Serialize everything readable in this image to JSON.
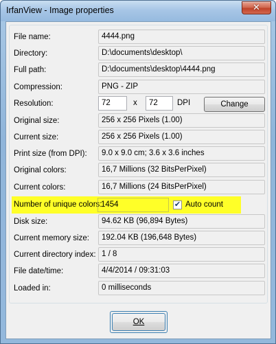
{
  "window": {
    "title": "IrfanView - Image properties",
    "close_symbol": "✕"
  },
  "rows": [
    {
      "label": "File name:",
      "value": "4444.png"
    },
    {
      "label": "Directory:",
      "value": "D:\\documents\\desktop\\"
    },
    {
      "label": "Full path:",
      "value": "D:\\documents\\desktop\\4444.png"
    },
    {
      "label": "Compression:",
      "value": "PNG - ZIP"
    },
    {
      "label": "Resolution:"
    },
    {
      "label": "Original size:",
      "value": "256 x 256  Pixels (1.00)"
    },
    {
      "label": "Current size:",
      "value": "256 x 256  Pixels (1.00)"
    },
    {
      "label": "Print size (from DPI):",
      "value": "9.0 x 9.0 cm; 3.6 x 3.6 inches"
    },
    {
      "label": "Original colors:",
      "value": "16,7 Millions   (32 BitsPerPixel)"
    },
    {
      "label": "Current colors:",
      "value": "16,7 Millions   (24 BitsPerPixel)"
    },
    {
      "label": "Number of unique colors:",
      "value": "1454"
    },
    {
      "label": "Disk size:",
      "value": "94.62 KB (96,894 Bytes)"
    },
    {
      "label": "Current memory size:",
      "value": "192.04  KB (196,648 Bytes)"
    },
    {
      "label": "Current directory index:",
      "value": "1  /  8"
    },
    {
      "label": "File date/time:",
      "value": "4/4/2014 / 09:31:03"
    },
    {
      "label": "Loaded in:",
      "value": "0 milliseconds"
    }
  ],
  "resolution": {
    "dpi_x": "72",
    "separator": "x",
    "dpi_y": "72",
    "unit": "DPI",
    "change_label": "Change"
  },
  "auto_count": {
    "label": "Auto count",
    "checked": true,
    "check_symbol": "✔"
  },
  "ok_label": "OK",
  "colors": {
    "highlight": "#ffff28",
    "title_bar": "#a7c6e6",
    "close_button": "#c0432a"
  }
}
